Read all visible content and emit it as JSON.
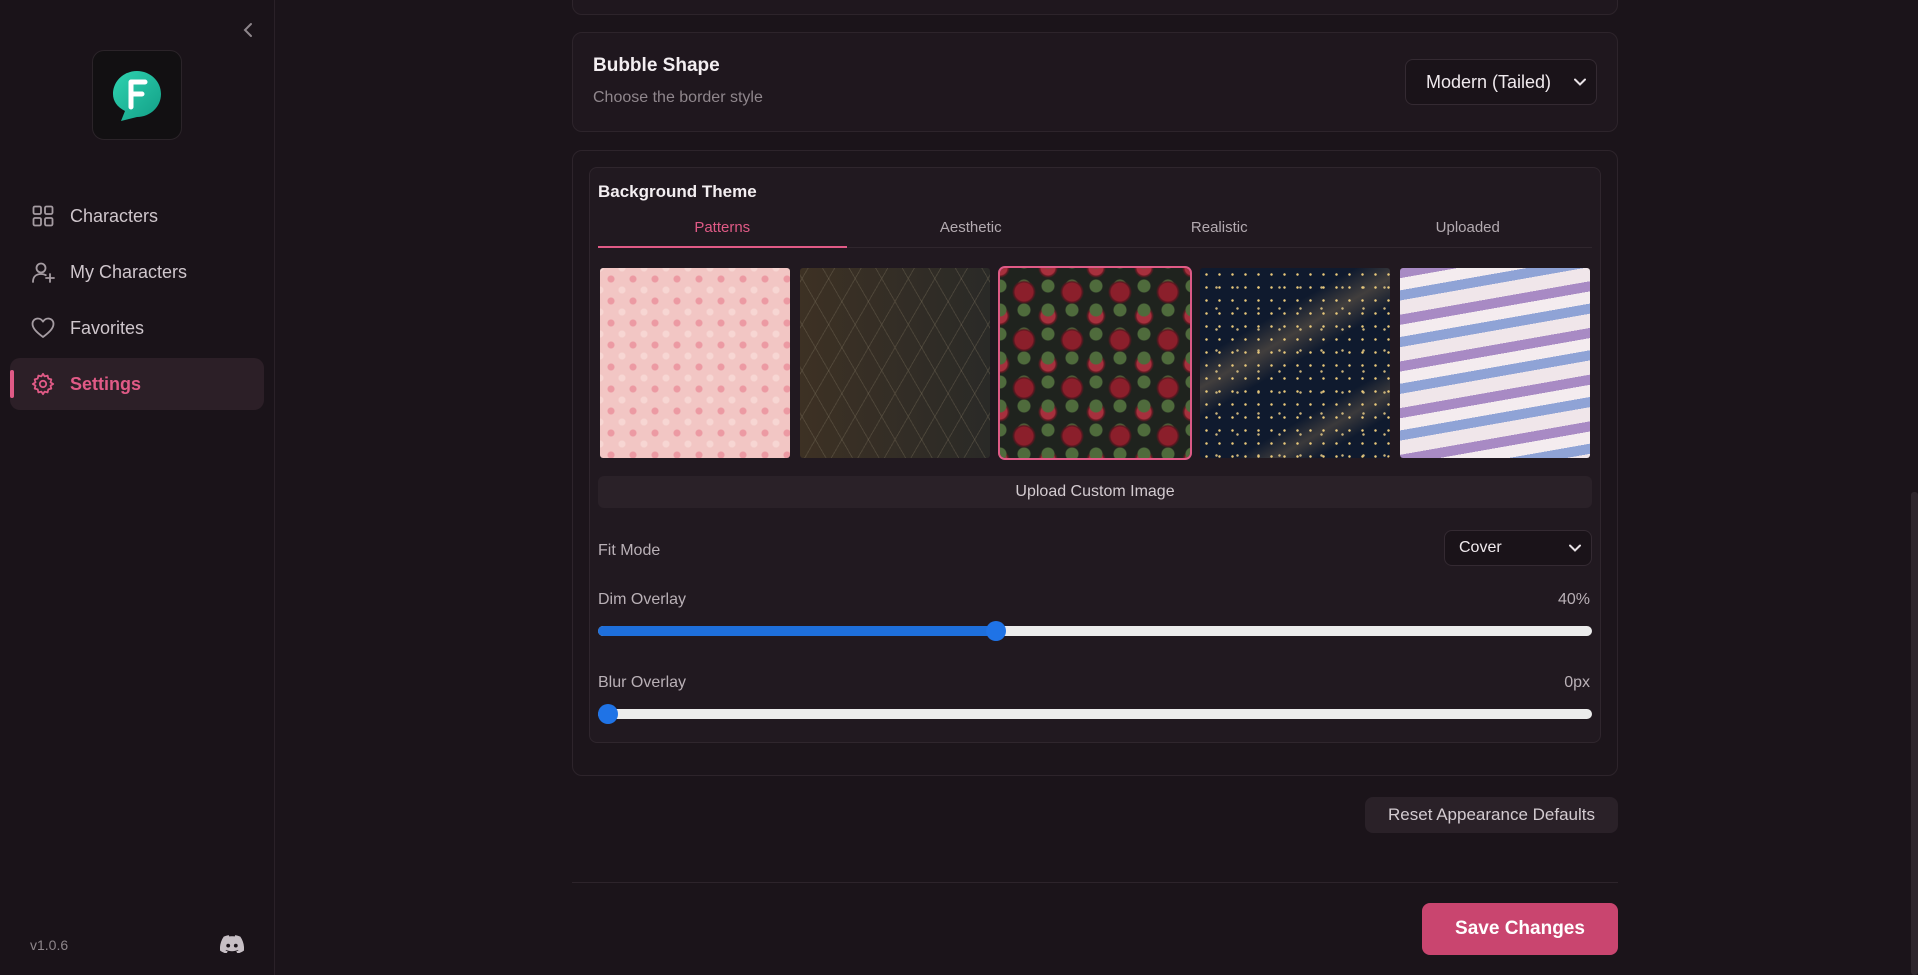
{
  "app": {
    "version": "v1.0.6"
  },
  "sidebar": {
    "items": [
      {
        "label": "Characters",
        "icon": "grid-icon"
      },
      {
        "label": "My Characters",
        "icon": "user-plus-icon"
      },
      {
        "label": "Favorites",
        "icon": "heart-icon"
      },
      {
        "label": "Settings",
        "icon": "gear-icon",
        "active": true
      }
    ]
  },
  "bubble_shape": {
    "title": "Bubble Shape",
    "subtitle": "Choose the border style",
    "selected": "Modern (Tailed)"
  },
  "background_theme": {
    "title": "Background Theme",
    "tabs": [
      {
        "label": "Patterns",
        "active": true
      },
      {
        "label": "Aesthetic"
      },
      {
        "label": "Realistic"
      },
      {
        "label": "Uploaded"
      }
    ],
    "thumbnails": [
      {
        "name": "pink-hearts-pattern"
      },
      {
        "name": "dark-geometric-pattern"
      },
      {
        "name": "dark-roses-pattern",
        "selected": true
      },
      {
        "name": "starry-night-pattern"
      },
      {
        "name": "pastel-waves-pattern"
      }
    ],
    "upload_label": "Upload Custom Image",
    "fit_mode": {
      "label": "Fit Mode",
      "value": "Cover"
    },
    "dim_overlay": {
      "label": "Dim Overlay",
      "value_text": "40%",
      "value": 0.4
    },
    "blur_overlay": {
      "label": "Blur Overlay",
      "value_text": "0px",
      "value": 0
    }
  },
  "actions": {
    "reset_label": "Reset Appearance Defaults",
    "save_label": "Save Changes"
  },
  "colors": {
    "accent": "#e05a86",
    "save": "#c9456f",
    "slider": "#1e6fdb",
    "background": "#1b141a"
  }
}
